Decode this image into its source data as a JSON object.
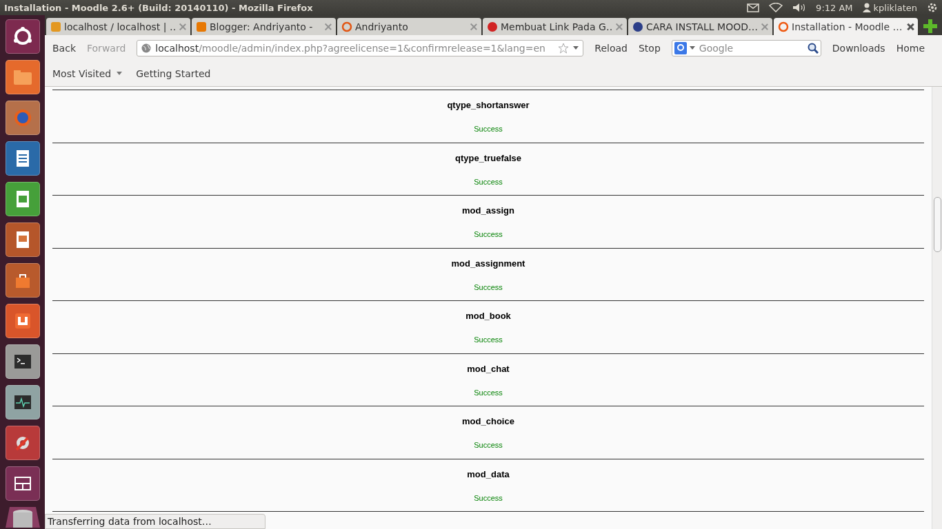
{
  "window": {
    "title": "Installation - Moodle 2.6+ (Build: 20140110) - Mozilla Firefox"
  },
  "panel": {
    "time": "9:12 AM",
    "user": "kpliklaten"
  },
  "tabs": [
    {
      "label": "localhost / localhost | …",
      "selected": false
    },
    {
      "label": "Blogger: Andriyanto -",
      "selected": false
    },
    {
      "label": "Andriyanto",
      "selected": false
    },
    {
      "label": "Membuat Link Pada G…",
      "selected": false
    },
    {
      "label": "CARA INSTALL MOOD…",
      "selected": false
    },
    {
      "label": "Installation - Moodle …",
      "selected": true
    }
  ],
  "nav": {
    "back": {
      "label": "Back",
      "disabled": false
    },
    "forward": {
      "label": "Forward",
      "disabled": true
    },
    "url_host": "localhost",
    "url_path": "/moodle/admin/index.php?agreelicense=1&confirmrelease=1&lang=en",
    "reload": "Reload",
    "stop": "Stop",
    "search_placeholder": "Google",
    "downloads": "Downloads",
    "home": "Home"
  },
  "bookmarks": [
    {
      "label": "Most Visited",
      "dropdown": true
    },
    {
      "label": "Getting Started",
      "dropdown": false
    }
  ],
  "rows": [
    {
      "name": "qtype_shortanswer",
      "status": "Success"
    },
    {
      "name": "qtype_truefalse",
      "status": "Success"
    },
    {
      "name": "mod_assign",
      "status": "Success"
    },
    {
      "name": "mod_assignment",
      "status": "Success"
    },
    {
      "name": "mod_book",
      "status": "Success"
    },
    {
      "name": "mod_chat",
      "status": "Success"
    },
    {
      "name": "mod_choice",
      "status": "Success"
    },
    {
      "name": "mod_data",
      "status": "Success"
    }
  ],
  "status_bar": "Transferring data from localhost…"
}
